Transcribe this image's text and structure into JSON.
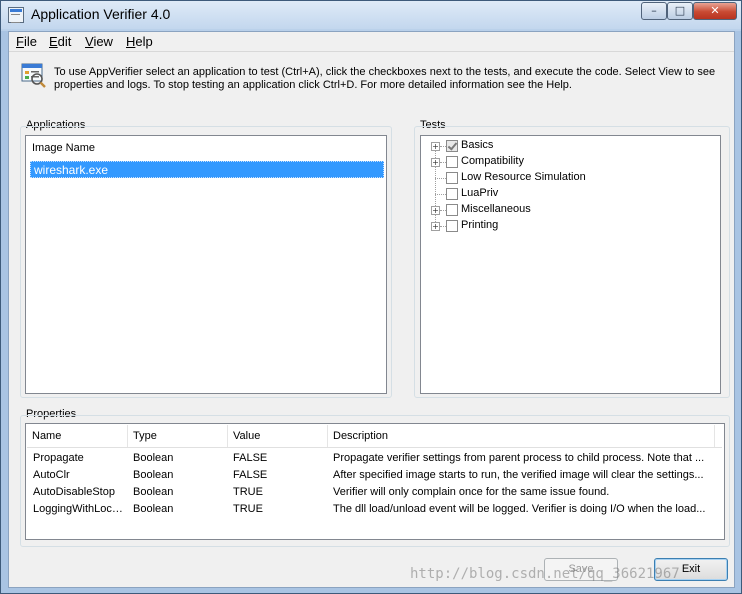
{
  "window": {
    "title": "Application Verifier 4.0",
    "controls": {
      "minimize": "–",
      "maximize": "□",
      "close": "✕"
    }
  },
  "menu": {
    "items": [
      "File",
      "Edit",
      "View",
      "Help"
    ]
  },
  "help": {
    "icon": "verifier-info-icon",
    "text": "To use AppVerifier select an application to test (Ctrl+A), click the checkboxes next to the tests, and execute the code. Select View to see properties and logs. To stop testing an application click Ctrl+D. For more detailed information see the Help."
  },
  "applications": {
    "label": "Applications",
    "column": "Image Name",
    "items": [
      "wireshark.exe"
    ]
  },
  "tests": {
    "label": "Tests",
    "items": [
      {
        "label": "Basics",
        "expandable": true,
        "checked": true
      },
      {
        "label": "Compatibility",
        "expandable": true,
        "checked": false
      },
      {
        "label": "Low Resource Simulation",
        "expandable": false,
        "checked": false
      },
      {
        "label": "LuaPriv",
        "expandable": false,
        "checked": false
      },
      {
        "label": "Miscellaneous",
        "expandable": true,
        "checked": false
      },
      {
        "label": "Printing",
        "expandable": true,
        "checked": false
      }
    ]
  },
  "properties": {
    "label": "Properties",
    "columns": [
      "Name",
      "Type",
      "Value",
      "Description"
    ],
    "rows": [
      [
        "Propagate",
        "Boolean",
        "FALSE",
        "Propagate verifier settings from parent process to child process. Note that ..."
      ],
      [
        "AutoClr",
        "Boolean",
        "FALSE",
        "After specified image starts to run, the verified image will clear the settings..."
      ],
      [
        "AutoDisableStop",
        "Boolean",
        "TRUE",
        "Verifier will only complain once for the same issue found."
      ],
      [
        "LoggingWithLock...",
        "Boolean",
        "TRUE",
        "The dll load/unload event will be logged. Verifier is doing I/O when the load..."
      ]
    ]
  },
  "buttons": {
    "save": "Save",
    "exit": "Exit"
  },
  "watermark": "http://blog.csdn.net/qq_36621967"
}
